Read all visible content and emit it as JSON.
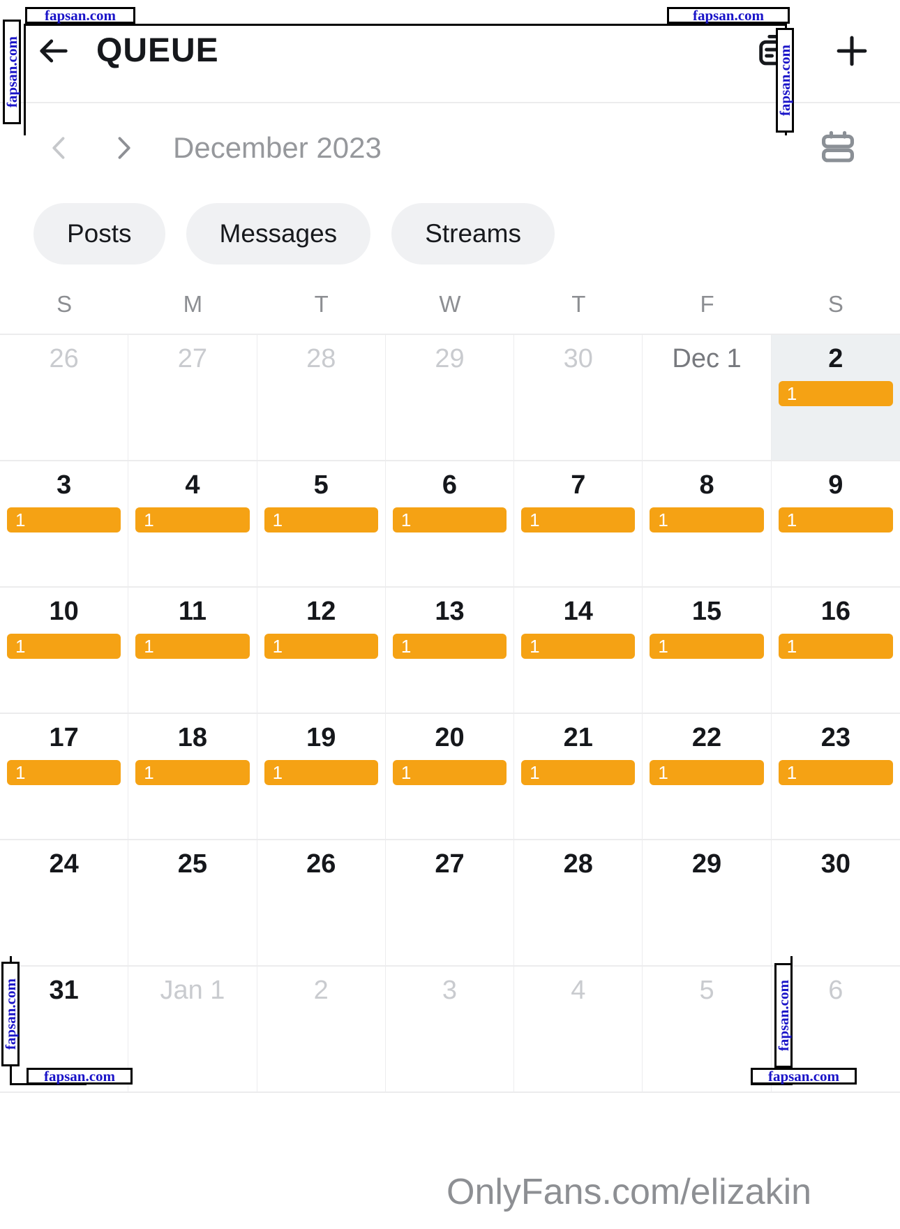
{
  "appbar": {
    "title": "QUEUE",
    "back_icon": "arrow-left-icon",
    "queue_icon": "document-duplicate-icon",
    "add_icon": "plus-icon"
  },
  "month_nav": {
    "prev_icon": "chevron-left-icon",
    "next_icon": "chevron-right-icon",
    "label": "December 2023",
    "view_toggle_icon": "calendar-layout-toggle-icon"
  },
  "filters": [
    {
      "label": "Posts"
    },
    {
      "label": "Messages"
    },
    {
      "label": "Streams"
    }
  ],
  "weekdays": [
    "S",
    "M",
    "T",
    "W",
    "T",
    "F",
    "S"
  ],
  "colors": {
    "badge_orange": "#f5a214",
    "today_background": "#edf0f2",
    "muted_day": "#c9cbcf",
    "grid_line": "#ececed"
  },
  "calendar": {
    "cells": [
      {
        "label": "26",
        "state": "muted",
        "count": null
      },
      {
        "label": "27",
        "state": "muted",
        "count": null
      },
      {
        "label": "28",
        "state": "muted",
        "count": null
      },
      {
        "label": "29",
        "state": "muted",
        "count": null
      },
      {
        "label": "30",
        "state": "muted",
        "count": null
      },
      {
        "label": "Dec 1",
        "state": "firstofmonth",
        "count": null
      },
      {
        "label": "2",
        "state": "today",
        "count": "1"
      },
      {
        "label": "3",
        "state": "normal",
        "count": "1"
      },
      {
        "label": "4",
        "state": "normal",
        "count": "1"
      },
      {
        "label": "5",
        "state": "normal",
        "count": "1"
      },
      {
        "label": "6",
        "state": "normal",
        "count": "1"
      },
      {
        "label": "7",
        "state": "normal",
        "count": "1"
      },
      {
        "label": "8",
        "state": "normal",
        "count": "1"
      },
      {
        "label": "9",
        "state": "normal",
        "count": "1"
      },
      {
        "label": "10",
        "state": "normal",
        "count": "1"
      },
      {
        "label": "11",
        "state": "normal",
        "count": "1"
      },
      {
        "label": "12",
        "state": "normal",
        "count": "1"
      },
      {
        "label": "13",
        "state": "normal",
        "count": "1"
      },
      {
        "label": "14",
        "state": "normal",
        "count": "1"
      },
      {
        "label": "15",
        "state": "normal",
        "count": "1"
      },
      {
        "label": "16",
        "state": "normal",
        "count": "1"
      },
      {
        "label": "17",
        "state": "normal",
        "count": "1"
      },
      {
        "label": "18",
        "state": "normal",
        "count": "1"
      },
      {
        "label": "19",
        "state": "normal",
        "count": "1"
      },
      {
        "label": "20",
        "state": "normal",
        "count": "1"
      },
      {
        "label": "21",
        "state": "normal",
        "count": "1"
      },
      {
        "label": "22",
        "state": "normal",
        "count": "1"
      },
      {
        "label": "23",
        "state": "normal",
        "count": "1"
      },
      {
        "label": "24",
        "state": "normal",
        "count": null
      },
      {
        "label": "25",
        "state": "normal",
        "count": null
      },
      {
        "label": "26",
        "state": "normal",
        "count": null
      },
      {
        "label": "27",
        "state": "normal",
        "count": null
      },
      {
        "label": "28",
        "state": "normal",
        "count": null
      },
      {
        "label": "29",
        "state": "normal",
        "count": null
      },
      {
        "label": "30",
        "state": "normal",
        "count": null
      },
      {
        "label": "31",
        "state": "normal",
        "count": null
      },
      {
        "label": "Jan 1",
        "state": "muted",
        "count": null
      },
      {
        "label": "2",
        "state": "muted",
        "count": null
      },
      {
        "label": "3",
        "state": "muted",
        "count": null
      },
      {
        "label": "4",
        "state": "muted",
        "count": null
      },
      {
        "label": "5",
        "state": "muted",
        "count": null
      },
      {
        "label": "6",
        "state": "muted",
        "count": null
      }
    ]
  },
  "watermarks": {
    "onlyfans": "OnlyFans.com/elizakin",
    "site": "fapsan.com"
  }
}
